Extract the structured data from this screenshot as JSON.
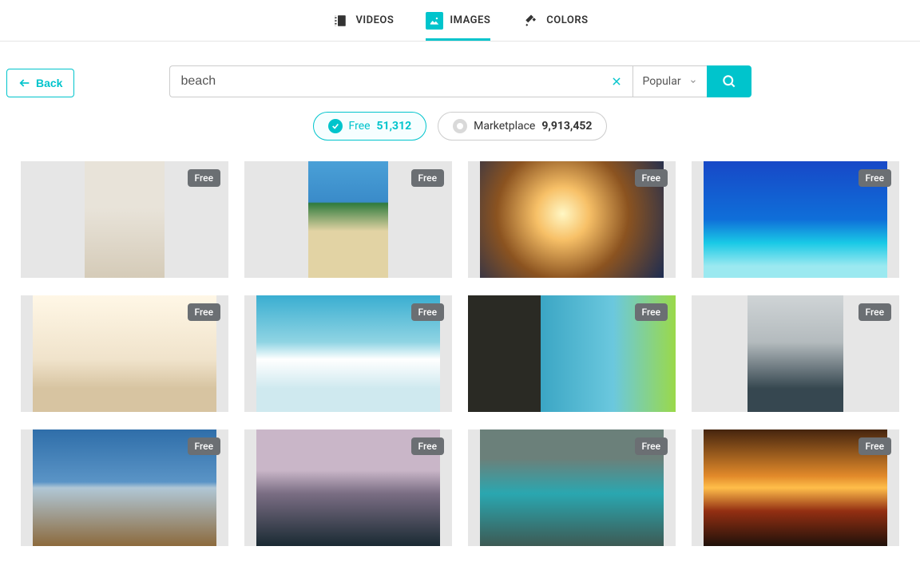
{
  "tabs": {
    "videos": "VIDEOS",
    "images": "IMAGES",
    "colors": "COLORS"
  },
  "back_label": "Back",
  "search": {
    "value": "beach",
    "sort": "Popular"
  },
  "filters": {
    "free_label": "Free",
    "free_count": "51,312",
    "market_label": "Marketplace",
    "market_count": "9,913,452"
  },
  "results": {
    "badge": "Free"
  }
}
